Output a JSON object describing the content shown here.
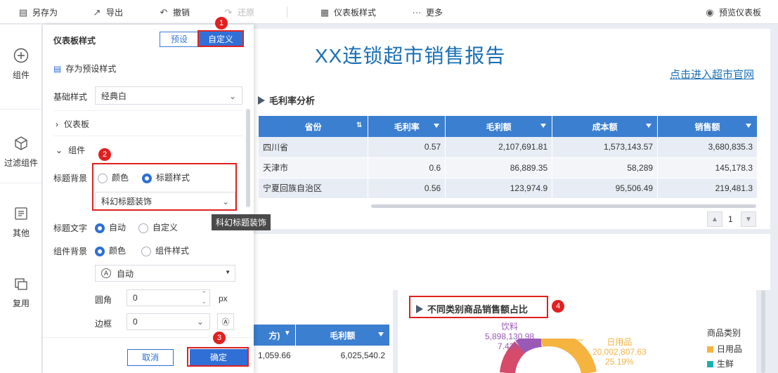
{
  "toolbar": {
    "save_as": "另存为",
    "export": "导出",
    "undo": "撤销",
    "redo": "还原",
    "dashboard_style": "仪表板样式",
    "more": "更多",
    "preview": "预览仪表板"
  },
  "leftbar": {
    "items": [
      {
        "label": "组件",
        "icon": "plus-circle-icon"
      },
      {
        "label": "过滤组件",
        "icon": "cube-icon"
      },
      {
        "label": "其他",
        "icon": "document-icon"
      },
      {
        "label": "复用",
        "icon": "copy-icon"
      }
    ]
  },
  "panel": {
    "title": "仪表板样式",
    "tab_preset": "预设",
    "tab_custom": "自定义",
    "save_preset": "存为预设样式",
    "base_style_label": "基础样式",
    "base_style_value": "经典白",
    "section_dashboard": "仪表板",
    "section_component": "组件",
    "title_bg_label": "标题背景",
    "title_bg_color": "颜色",
    "title_bg_style": "标题样式",
    "title_style_value": "科幻标题装饰",
    "title_text_label": "标题文字",
    "title_text_auto": "自动",
    "title_text_custom": "自定义",
    "comp_bg_label": "组件背景",
    "comp_bg_color": "颜色",
    "comp_bg_style": "组件样式",
    "auto_value": "自动",
    "radius_label": "圆角",
    "radius_value": "0",
    "radius_unit": "px",
    "border_label": "边框",
    "border_value": "0",
    "cancel": "取消",
    "confirm": "确定",
    "tooltip": "科幻标题装饰"
  },
  "badges": [
    "1",
    "2",
    "3",
    "4"
  ],
  "report": {
    "title": "XX连锁超市销售报告",
    "link": "点击进入超市官网",
    "section1": "毛利率分析",
    "columns": [
      "省份",
      "毛利率",
      "毛利额",
      "成本额",
      "销售额"
    ],
    "rows": [
      [
        "四川省",
        "0.57",
        "2,107,691.81",
        "1,573,143.57",
        "3,680,835.3"
      ],
      [
        "天津市",
        "0.6",
        "86,889.35",
        "58,289",
        "145,178.3"
      ],
      [
        "宁夏回族自治区",
        "0.56",
        "123,974.9",
        "95,506.49",
        "219,481.3"
      ]
    ],
    "page": "1",
    "section2": "不同类别商品销售额占比",
    "table2": {
      "col_partial": "方)",
      "col2": "毛利额",
      "row": [
        "1,059.66",
        "6,025,540.2"
      ]
    },
    "legend_title": "商品类别",
    "legend": [
      {
        "name": "日用品",
        "color": "#f5b340"
      },
      {
        "name": "生鲜",
        "color": "#18b0b0"
      }
    ],
    "pie_labels": [
      {
        "name": "饮料",
        "value": "5,898,130.98",
        "pct": "7.43%",
        "color": "#9b59b6"
      },
      {
        "name": "日用品",
        "value": "20,002,807.63",
        "pct": "25.19%",
        "color": "#f5b340"
      }
    ]
  },
  "chart_data": {
    "type": "pie",
    "title": "不同类别商品销售额占比",
    "legend_title": "商品类别",
    "categories": [
      "饮料",
      "日用品"
    ],
    "values": [
      5898130.98,
      20002807.63
    ],
    "percentages": [
      7.43,
      25.19
    ]
  }
}
